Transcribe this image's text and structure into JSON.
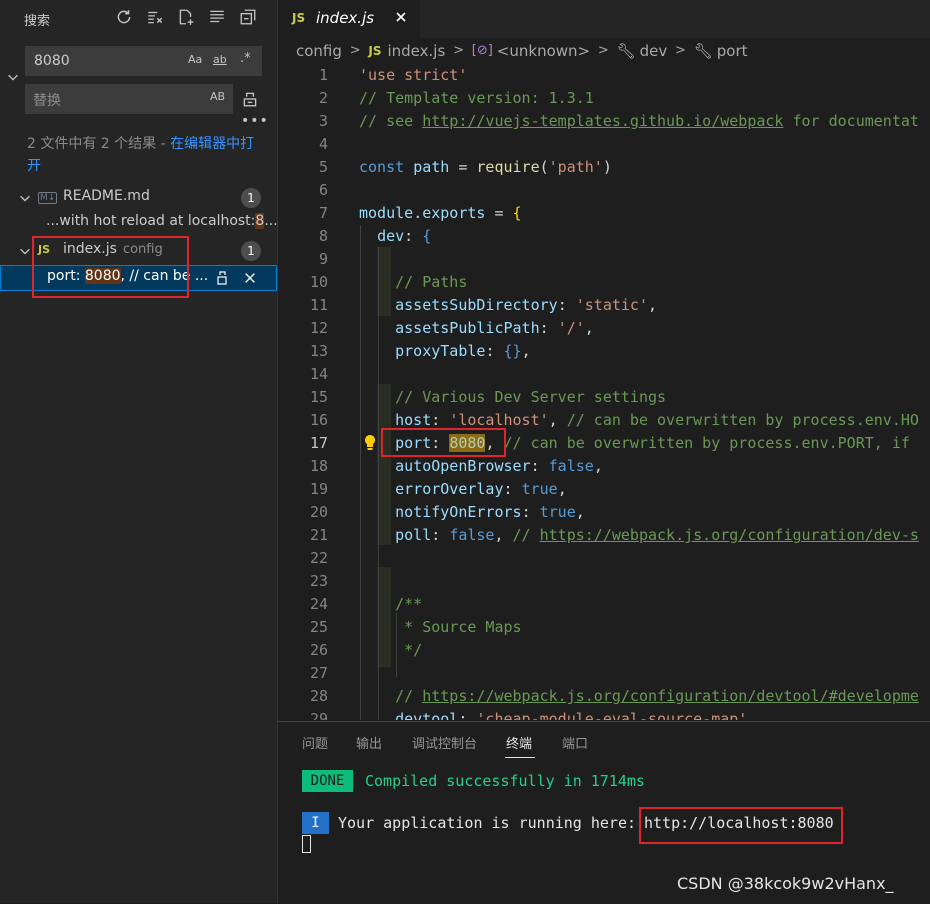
{
  "sidebar": {
    "title": "搜索",
    "search": {
      "value": "8080",
      "opt_case": "Aa",
      "opt_word": "ab",
      "opt_regex": ".*"
    },
    "replace": {
      "placeholder": "替换",
      "opt_preserve": "AB"
    },
    "summary": {
      "prefix": "2 文件中有 2 个结果 - ",
      "link": "在编辑器中打开"
    },
    "files": [
      {
        "icon": "M↓",
        "name": "README.md",
        "desc": "",
        "count": "1",
        "match": {
          "before": "...with hot reload at localhost:",
          "hit": "8",
          "after": "..."
        }
      },
      {
        "icon": "JS",
        "name": "index.js",
        "desc": "config",
        "count": "1",
        "match": {
          "before": "port: ",
          "hit": "8080",
          "after": ", // can be ..."
        }
      }
    ]
  },
  "tab": {
    "icon": "JS",
    "label": "index.js"
  },
  "breadcrumb": [
    "config",
    "index.js",
    "<unknown>",
    "dev",
    "port"
  ],
  "editor": {
    "active_line": "17",
    "lines": [
      "1",
      "2",
      "3",
      "4",
      "5",
      "6",
      "7",
      "8",
      "9",
      "10",
      "11",
      "12",
      "13",
      "14",
      "15",
      "16",
      "17",
      "18",
      "19",
      "20",
      "21",
      "22",
      "23",
      "24",
      "25",
      "26",
      "27",
      "28",
      "29"
    ]
  },
  "code": {
    "l1": "'use strict'",
    "l2": "// Template version: 1.3.1",
    "l3a": "// see ",
    "l3b": "http://vuejs-templates.github.io/webpack",
    "l3c": " for documentat",
    "l5a": "const",
    "l5b": "path",
    "l5c": "require",
    "l5d": "'path'",
    "l7a": "module",
    "l7b": "exports",
    "l8a": "dev",
    "l10": "// Paths",
    "l11a": "assetsSubDirectory",
    "l11b": "'static'",
    "l12a": "assetsPublicPath",
    "l12b": "'/'",
    "l13a": "proxyTable",
    "l15": "// Various Dev Server settings",
    "l16a": "host",
    "l16b": "'localhost'",
    "l16c": "// can be overwritten by process.env.HO",
    "l17a": "port",
    "l17b": "8080",
    "l17c": "// can be overwritten by process.env.PORT, if",
    "l18a": "autoOpenBrowser",
    "l18b": "false",
    "l19a": "errorOverlay",
    "l19b": "true",
    "l20a": "notifyOnErrors",
    "l20b": "true",
    "l21a": "poll",
    "l21b": "false",
    "l21c": "// ",
    "l21d": "https://webpack.js.org/configuration/dev-s",
    "l24": "/**",
    "l25": " * Source Maps",
    "l26": " */",
    "l28a": "// ",
    "l28b": "https://webpack.js.org/configuration/devtool/#developme",
    "l29a": "devtool",
    "l29b": "'cheap-module-eval-source-map'"
  },
  "panel": {
    "tabs": [
      "问题",
      "输出",
      "调试控制台",
      "终端",
      "端口"
    ],
    "active_tab": "终端",
    "done_badge": "DONE",
    "done_msg": "Compiled successfully in 1714ms",
    "info_badge": "I",
    "run_msg": "Your application is running here:",
    "run_url": "http://localhost:8080"
  },
  "watermark": "CSDN @38kcok9w2vHanx_",
  "colors": {
    "highlight_box": "#e0242b",
    "accent": "#007fd4"
  }
}
